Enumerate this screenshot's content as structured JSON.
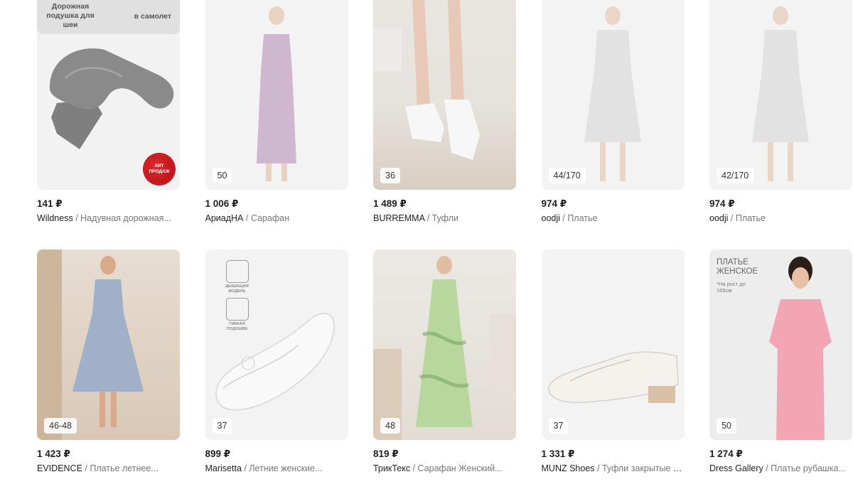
{
  "products": [
    {
      "price": "141 ₽",
      "brand": "Wildness",
      "name": "Надувная дорожная...",
      "badge": "",
      "promo_left": "Дорожная подушка для шеи",
      "promo_right": "в самолет",
      "sticker": "ХИТ ПРОДАЖ",
      "image_icon": "neck-pillow-image"
    },
    {
      "price": "1 006 ₽",
      "brand": "АриадНА",
      "name": "Сарафан",
      "badge": "50",
      "image_icon": "lilac-sundress-image"
    },
    {
      "price": "1 489 ₽",
      "brand": "BURREMMA",
      "name": "Туфли",
      "badge": "36",
      "image_icon": "white-shoes-on-feet-image"
    },
    {
      "price": "974 ₽",
      "brand": "oodji",
      "name": "Платье",
      "badge": "44/170",
      "image_icon": "floral-dress-image"
    },
    {
      "price": "974 ₽",
      "brand": "oodji",
      "name": "Платье",
      "badge": "42/170",
      "image_icon": "floral-dress-image"
    },
    {
      "price": "1 423 ₽",
      "brand": "EVIDENCE",
      "name": "Платье летнее...",
      "badge": "46-48",
      "image_icon": "blue-striped-dress-image"
    },
    {
      "price": "899 ₽",
      "brand": "Marisetta",
      "name": "Летние женские...",
      "badge": "37",
      "feature_top": "ДЫШАЩАЯ МОДЕЛЬ",
      "feature_bottom": "ГИБКАЯ ПОДОШВА",
      "image_icon": "white-ballet-flat-image"
    },
    {
      "price": "819 ₽",
      "brand": "ТрикТекс",
      "name": "Сарафан Женский...",
      "badge": "48",
      "image_icon": "green-tie-dye-dress-image"
    },
    {
      "price": "1 331 ₽",
      "brand": "MUNZ Shoes",
      "name": "Туфли закрытые с...",
      "badge": "37",
      "image_icon": "white-loafer-image"
    },
    {
      "price": "1 274 ₽",
      "brand": "Dress Gallery",
      "name": "Платье рубашка...",
      "badge": "50",
      "overlay_title": "ПЛАТЬЕ ЖЕНСКОЕ",
      "overlay_note": "*На рост до 165см",
      "image_icon": "pink-shirt-dress-image"
    }
  ],
  "separator": " / ",
  "colors": {
    "price": "#1f1f1f",
    "brand": "#1f1f1f",
    "name": "#777777",
    "badge_bg": "#ffffff",
    "sticker": "#d0141c"
  }
}
